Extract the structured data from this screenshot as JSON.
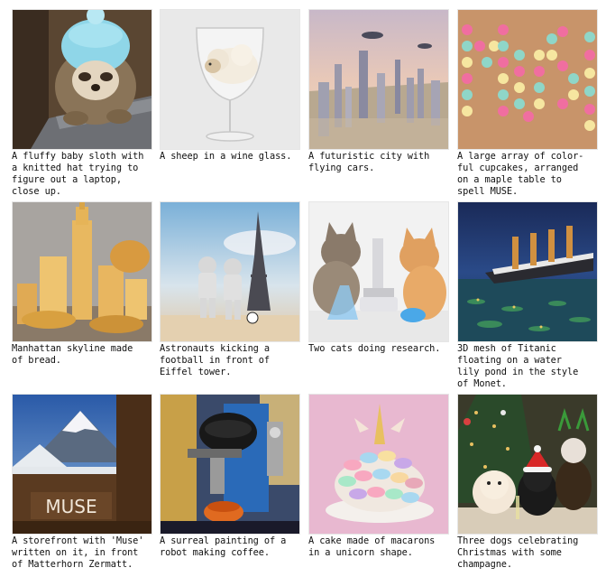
{
  "figure": {
    "captions": [
      "A fluffy baby sloth with\na knitted hat trying to\nfigure out a laptop,\nclose up.",
      "A sheep in a wine glass.",
      "A futuristic city with\nflying cars.",
      "A large array of color-\nful cupcakes, arranged\non a maple table to\nspell MUSE.",
      "Manhattan skyline made\nof bread.",
      "Astronauts kicking a\nfootball in front of\nEiffel tower.",
      "Two cats doing research.",
      "3D mesh of Titanic\nfloating on a water\nlily pond in the style\nof Monet.",
      "A storefront with 'Muse'\nwritten on it, in front\nof Matterhorn Zermatt.",
      "A surreal painting of a\nrobot making coffee.",
      "A cake made of macarons\nin a unicorn shape.",
      "Three dogs celebrating\nChristmas with some\nchampagne."
    ],
    "storefront_sign_text": "MUSE"
  }
}
